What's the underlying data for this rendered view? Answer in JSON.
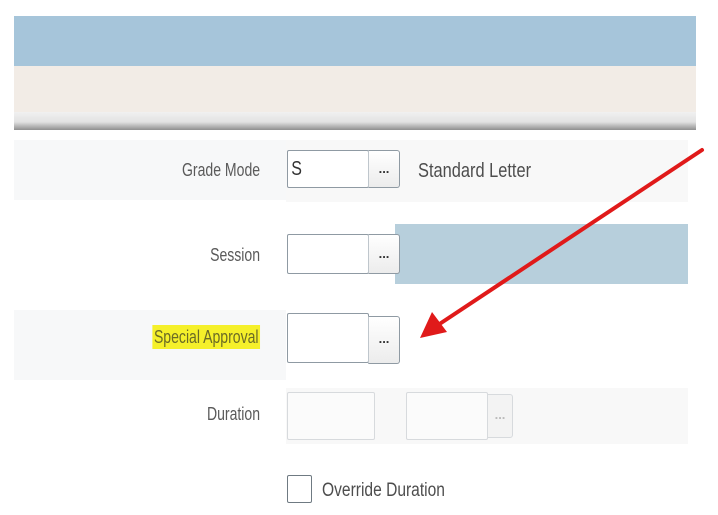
{
  "form": {
    "grade_mode": {
      "label": "Grade Mode",
      "value": "S",
      "lookup_label": "...",
      "description": "Standard Letter"
    },
    "session": {
      "label": "Session",
      "value": "",
      "lookup_label": "..."
    },
    "special_approval": {
      "label": "Special Approval",
      "value": "",
      "lookup_label": "...",
      "highlight_color": "#f5f02a"
    },
    "duration": {
      "label": "Duration",
      "value": "",
      "unit_value": "",
      "lookup_label": "..."
    },
    "override_duration": {
      "label": "Override Duration",
      "checked": false
    }
  },
  "annotation": {
    "arrow_color": "#e01a1a"
  },
  "colors": {
    "header_band": "#a6c5da",
    "row_highlight": "#b7cfdc"
  }
}
